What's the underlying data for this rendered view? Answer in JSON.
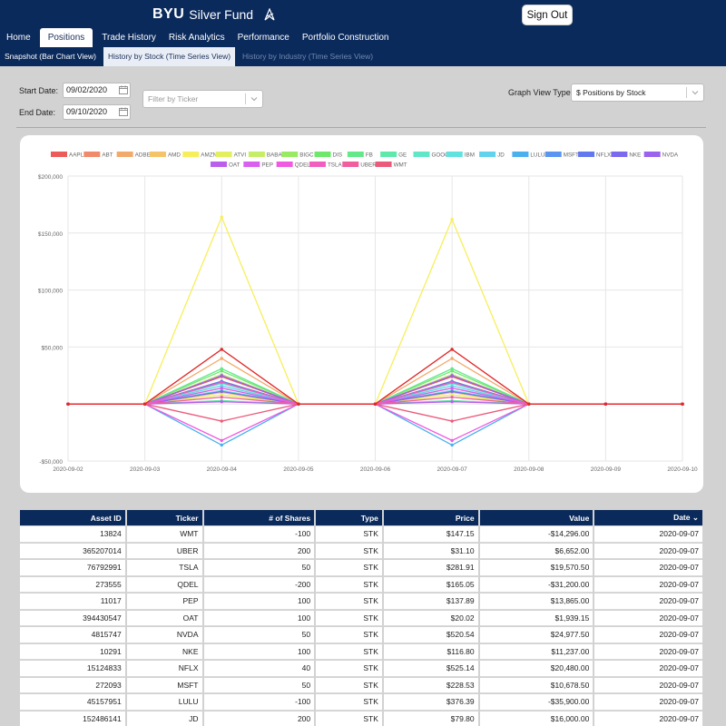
{
  "header": {
    "brand_byu": "BYU",
    "brand_name": "Silver Fund",
    "signout_label": "Sign Out"
  },
  "main_nav": [
    {
      "label": "Home",
      "active": false
    },
    {
      "label": "Positions",
      "active": true
    },
    {
      "label": "Trade History",
      "active": false
    },
    {
      "label": "Risk Analytics",
      "active": false
    },
    {
      "label": "Performance",
      "active": false
    },
    {
      "label": "Portfolio Construction",
      "active": false
    }
  ],
  "sub_nav": [
    {
      "label": "Snapshot (Bar Chart View)",
      "state": "normal"
    },
    {
      "label": "History by Stock (Time Series View)",
      "state": "active"
    },
    {
      "label": "History by Industry (Time Series View)",
      "state": "faded"
    }
  ],
  "filters": {
    "start_date_label": "Start Date:",
    "start_date_value": "09/02/2020",
    "end_date_label": "End Date:",
    "end_date_value": "09/10/2020",
    "ticker_placeholder": "Filter by Ticker",
    "graph_view_label": "Graph View Type:",
    "graph_view_value": "$ Positions by Stock"
  },
  "colors": {
    "navy": "#0b2a5c",
    "background": "#d2d2d2"
  },
  "chart_data": {
    "type": "line",
    "x": [
      "2020-09-02",
      "2020-09-03",
      "2020-09-04",
      "2020-09-05",
      "2020-09-06",
      "2020-09-07",
      "2020-09-08",
      "2020-09-09",
      "2020-09-10"
    ],
    "ylim": [
      -50000,
      200000
    ],
    "yticks": [
      -50000,
      0,
      50000,
      100000,
      150000,
      200000
    ],
    "ytick_labels": [
      "-$50,000",
      "",
      "$50,000",
      "$100,000",
      "$150,000",
      "$200,000"
    ],
    "grid": true,
    "legend_position": "top",
    "series": [
      {
        "name": "AAPL",
        "color": "#ec5a5a",
        "values": [
          0,
          0,
          24000,
          0,
          0,
          24000,
          0,
          0,
          0
        ]
      },
      {
        "name": "ABT",
        "color": "#f18a6a",
        "values": [
          0,
          0,
          14000,
          0,
          0,
          14000,
          0,
          0,
          0
        ]
      },
      {
        "name": "ADBE",
        "color": "#f3a96a",
        "values": [
          0,
          0,
          40000,
          0,
          0,
          40000,
          0,
          0,
          0
        ]
      },
      {
        "name": "AMD",
        "color": "#f5c46a",
        "values": [
          0,
          0,
          10000,
          0,
          0,
          10000,
          0,
          0,
          0
        ]
      },
      {
        "name": "AMZN",
        "color": "#f7ef5a",
        "values": [
          0,
          0,
          164000,
          0,
          0,
          162000,
          0,
          0,
          0
        ]
      },
      {
        "name": "ATVI",
        "color": "#e3ef5e",
        "values": [
          0,
          0,
          8000,
          0,
          0,
          8000,
          0,
          0,
          0
        ]
      },
      {
        "name": "BABA",
        "color": "#c4ee66",
        "values": [
          0,
          0,
          26000,
          0,
          0,
          26000,
          0,
          0,
          0
        ]
      },
      {
        "name": "BIGC",
        "color": "#98ea64",
        "values": [
          0,
          0,
          20000,
          0,
          0,
          20000,
          0,
          0,
          0
        ]
      },
      {
        "name": "DIS",
        "color": "#6ee86a",
        "values": [
          0,
          0,
          29000,
          0,
          0,
          29000,
          0,
          0,
          0
        ]
      },
      {
        "name": "FB",
        "color": "#64e88a",
        "values": [
          0,
          0,
          31000,
          0,
          0,
          31000,
          0,
          0,
          0
        ]
      },
      {
        "name": "GE",
        "color": "#5ee8aa",
        "values": [
          0,
          0,
          3000,
          0,
          0,
          3000,
          0,
          0,
          0
        ]
      },
      {
        "name": "GOOG",
        "color": "#62e6c8",
        "values": [
          0,
          0,
          18000,
          0,
          0,
          18000,
          0,
          0,
          0
        ]
      },
      {
        "name": "IBM",
        "color": "#62e2de",
        "values": [
          0,
          0,
          12000,
          0,
          0,
          12000,
          0,
          0,
          0
        ]
      },
      {
        "name": "JD",
        "color": "#62d2ee",
        "values": [
          0,
          0,
          16000,
          0,
          0,
          16000,
          0,
          0,
          0
        ]
      },
      {
        "name": "LULU",
        "color": "#4ab0ee",
        "values": [
          0,
          0,
          -36000,
          0,
          0,
          -36000,
          0,
          0,
          0
        ]
      },
      {
        "name": "MSFT",
        "color": "#5a96f0",
        "values": [
          0,
          0,
          11000,
          0,
          0,
          11000,
          0,
          0,
          0
        ]
      },
      {
        "name": "NFLX",
        "color": "#6278ee",
        "values": [
          0,
          0,
          20000,
          0,
          0,
          20000,
          0,
          0,
          0
        ]
      },
      {
        "name": "NKE",
        "color": "#7a6aee",
        "values": [
          0,
          0,
          11000,
          0,
          0,
          11000,
          0,
          0,
          0
        ]
      },
      {
        "name": "NVDA",
        "color": "#9a62ee",
        "values": [
          0,
          0,
          25000,
          0,
          0,
          25000,
          0,
          0,
          0
        ]
      },
      {
        "name": "OAT",
        "color": "#bb5eee",
        "values": [
          0,
          0,
          2000,
          0,
          0,
          2000,
          0,
          0,
          0
        ]
      },
      {
        "name": "PEP",
        "color": "#da5ef0",
        "values": [
          0,
          0,
          14000,
          0,
          0,
          14000,
          0,
          0,
          0
        ]
      },
      {
        "name": "QDEL",
        "color": "#f05ae0",
        "values": [
          0,
          0,
          -32000,
          0,
          0,
          -32000,
          0,
          0,
          0
        ]
      },
      {
        "name": "TSLA",
        "color": "#f25ec0",
        "values": [
          0,
          0,
          19000,
          0,
          0,
          19000,
          0,
          0,
          0
        ]
      },
      {
        "name": "UBER",
        "color": "#f05e9e",
        "values": [
          0,
          0,
          6000,
          0,
          0,
          6000,
          0,
          0,
          0
        ]
      },
      {
        "name": "WMT",
        "color": "#ec5a7a",
        "values": [
          0,
          0,
          -15000,
          0,
          0,
          -15000,
          0,
          0,
          0
        ]
      },
      {
        "name": "",
        "color": "#e02828",
        "values": [
          0,
          0,
          48000,
          0,
          0,
          48000,
          0,
          0,
          0
        ]
      }
    ]
  },
  "table": {
    "columns": [
      "Asset ID",
      "Ticker",
      "# of Shares",
      "Type",
      "Price",
      "Value",
      "Date"
    ],
    "sort_indicator": "⌄",
    "rows": [
      [
        "13824",
        "WMT",
        "-100",
        "STK",
        "$147.15",
        "-$14,296.00",
        "2020-09-07"
      ],
      [
        "365207014",
        "UBER",
        "200",
        "STK",
        "$31.10",
        "$6,652.00",
        "2020-09-07"
      ],
      [
        "76792991",
        "TSLA",
        "50",
        "STK",
        "$281.91",
        "$19,570.50",
        "2020-09-07"
      ],
      [
        "273555",
        "QDEL",
        "-200",
        "STK",
        "$165.05",
        "-$31,200.00",
        "2020-09-07"
      ],
      [
        "11017",
        "PEP",
        "100",
        "STK",
        "$137.89",
        "$13,865.00",
        "2020-09-07"
      ],
      [
        "394430547",
        "OAT",
        "100",
        "STK",
        "$20.02",
        "$1,939.15",
        "2020-09-07"
      ],
      [
        "4815747",
        "NVDA",
        "50",
        "STK",
        "$520.54",
        "$24,977.50",
        "2020-09-07"
      ],
      [
        "10291",
        "NKE",
        "100",
        "STK",
        "$116.80",
        "$11,237.00",
        "2020-09-07"
      ],
      [
        "15124833",
        "NFLX",
        "40",
        "STK",
        "$525.14",
        "$20,480.00",
        "2020-09-07"
      ],
      [
        "272093",
        "MSFT",
        "50",
        "STK",
        "$228.53",
        "$10,678.50",
        "2020-09-07"
      ],
      [
        "45157951",
        "LULU",
        "-100",
        "STK",
        "$376.39",
        "-$35,900.00",
        "2020-09-07"
      ],
      [
        "152486141",
        "JD",
        "200",
        "STK",
        "$79.80",
        "$16,000.00",
        "2020-09-07"
      ]
    ]
  }
}
